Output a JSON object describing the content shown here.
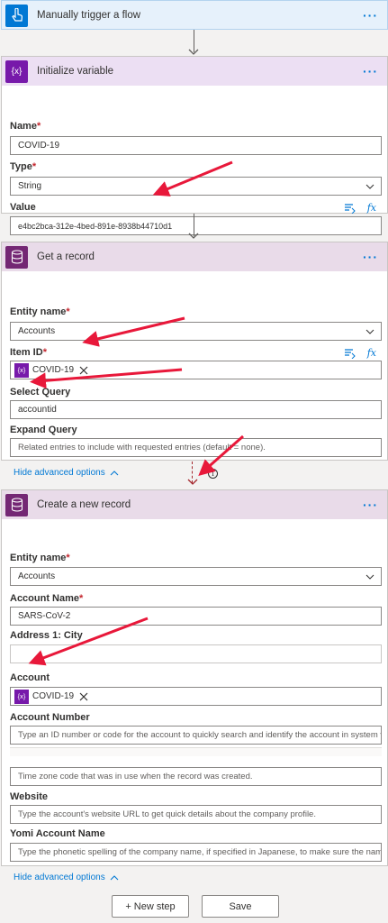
{
  "trigger": {
    "title": "Manually trigger a flow",
    "more": "···"
  },
  "init_variable": {
    "title": "Initialize variable",
    "icon_text": "{x}",
    "more": "···",
    "name_label": "Name",
    "name_value": "COVID-19",
    "type_label": "Type",
    "type_value": "String",
    "value_label": "Value",
    "value_value": "e4bc2bca-312e-4bed-891e-8938b44710d1",
    "fx": "fx"
  },
  "get_record": {
    "title": "Get a record",
    "more": "···",
    "entity_label": "Entity name",
    "entity_value": "Accounts",
    "itemid_label": "Item ID",
    "itemid_token": "COVID-19",
    "token_icon": "{x}",
    "select_label": "Select Query",
    "select_value": "accountid",
    "expand_label": "Expand Query",
    "expand_placeholder": "Related entries to include with requested entries (default = none).",
    "hide_advanced": "Hide advanced options",
    "fx": "fx"
  },
  "create_record": {
    "title": "Create a new record",
    "more": "···",
    "entity_label": "Entity name",
    "entity_value": "Accounts",
    "accname_label": "Account Name",
    "accname_value": "SARS-CoV-2",
    "city_label": "Address 1: City",
    "account_label": "Account",
    "account_token": "COVID-19",
    "token_icon": "{x}",
    "accnum_label": "Account Number",
    "accnum_placeholder": "Type an ID number or code for the account to quickly search and identify the account in system views.",
    "timezone_placeholder": "Time zone code that was in use when the record was created.",
    "website_label": "Website",
    "website_placeholder": "Type the account's website URL to get quick details about the company profile.",
    "yomi_label": "Yomi Account Name",
    "yomi_placeholder": "Type the phonetic spelling of the company name, if specified in Japanese, to make sure the name is pror",
    "hide_advanced": "Hide advanced options"
  },
  "footer": {
    "new_step": "+ New step",
    "save": "Save"
  },
  "colors": {
    "accent": "#0078d4",
    "variable": "#7719aa",
    "dataverse": "#742774",
    "trigger": "#0078d4",
    "arrow": "#e8183a"
  }
}
